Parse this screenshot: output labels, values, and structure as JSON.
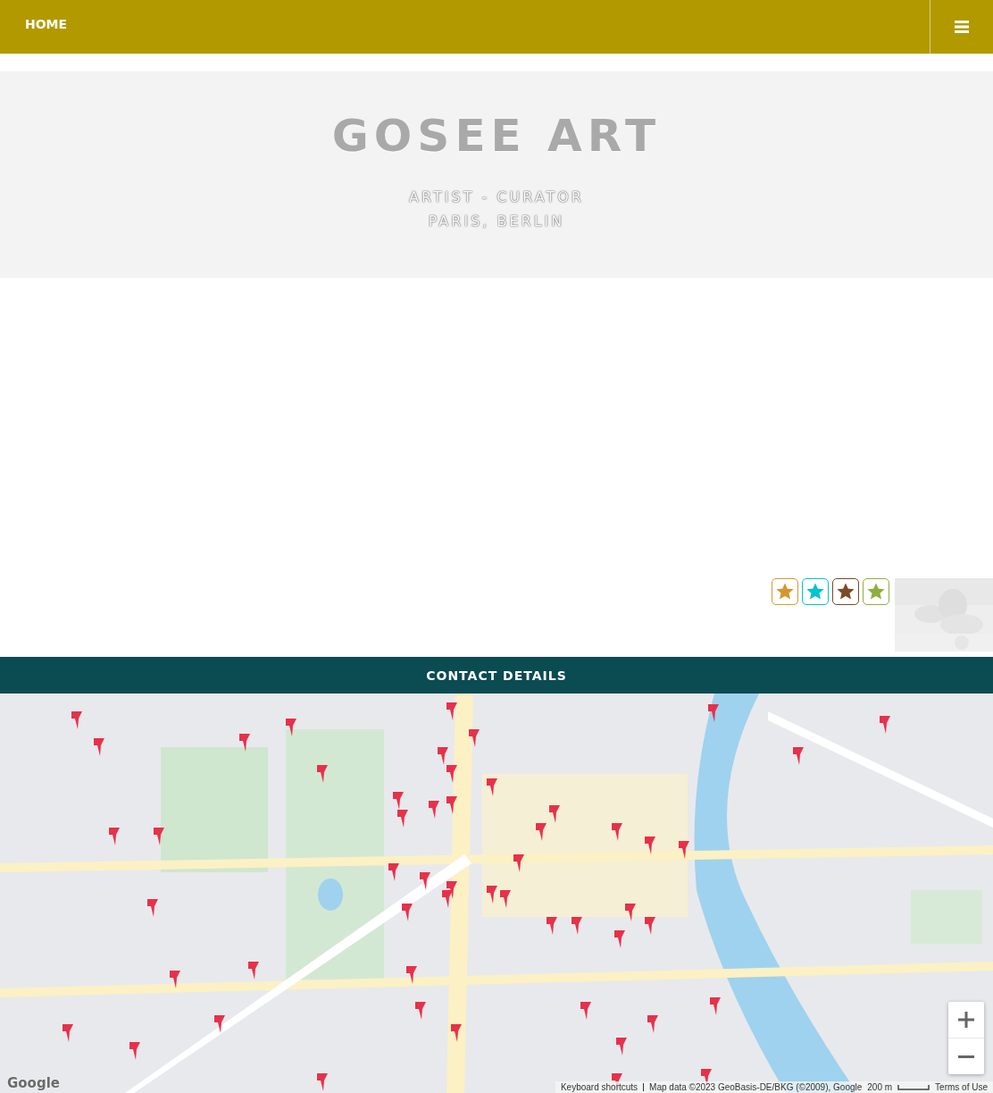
{
  "nav": {
    "home": "HOME"
  },
  "hero": {
    "title": "GOSEE ART",
    "lines": [
      "ARTIST - CURATOR",
      "PARIS, BERLIN"
    ]
  },
  "badges": [
    {
      "color": "#d4972e"
    },
    {
      "color": "#00c4d0"
    },
    {
      "color": "#7b4a26"
    },
    {
      "color": "#8fae3f"
    }
  ],
  "contact": {
    "title": "CONTACT DETAILS"
  },
  "map": {
    "logo": "Google",
    "attribution": [
      "Keyboard shortcuts",
      "Map data ©2023 GeoBasis-DE/BKG (©2009), Google",
      "200 m",
      "Terms of Use"
    ]
  }
}
